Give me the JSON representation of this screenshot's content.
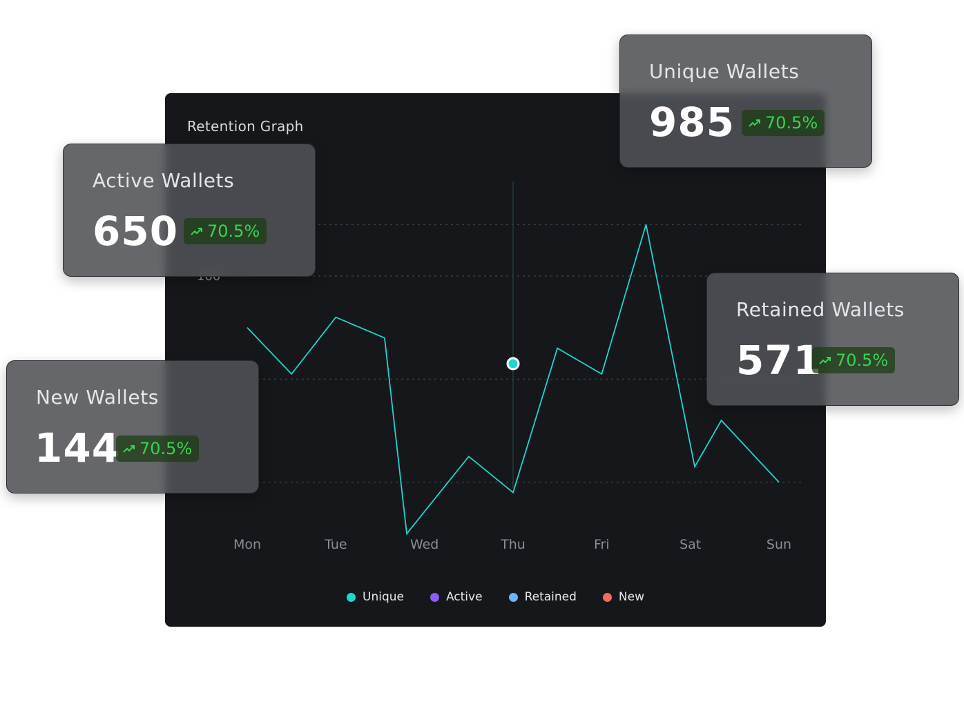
{
  "chart": {
    "title": "Retention Graph"
  },
  "chart_data": {
    "type": "line",
    "title": "Retention Graph",
    "categories": [
      "Mon",
      "Tue",
      "Wed",
      "Thu",
      "Fri",
      "Sat",
      "Sun"
    ],
    "x": [
      0,
      0.5,
      1,
      1.55,
      1.8,
      2.5,
      3,
      3.5,
      4,
      4.5,
      5.05,
      5.35,
      6
    ],
    "series": [
      {
        "name": "Unique",
        "color": "#1ed6cf",
        "y": [
          90,
          81,
          92,
          88,
          50,
          65,
          58,
          86,
          81,
          110,
          63,
          72,
          60
        ]
      }
    ],
    "y_tick_labels": [
      "100"
    ],
    "gridlines_y": [
      110,
      100,
      80,
      60
    ],
    "ylim": [
      55,
      115
    ],
    "highlight": {
      "category": "Thu",
      "y": 83
    },
    "grid": true
  },
  "legend": [
    {
      "label": "Unique",
      "color": "#1ed6cf"
    },
    {
      "label": "Active",
      "color": "#8b5cf6"
    },
    {
      "label": "Retained",
      "color": "#6cb4f5"
    },
    {
      "label": "New",
      "color": "#f26b5b"
    }
  ],
  "stats": {
    "unique": {
      "label": "Unique Wallets",
      "value": "985",
      "change": "70.5%"
    },
    "active": {
      "label": "Active Wallets",
      "value": "650",
      "change": "70.5%"
    },
    "retained": {
      "label": "Retained Wallets",
      "value": "571",
      "change": "70.5%"
    },
    "new": {
      "label": "New Wallets",
      "value": "144",
      "change": "70.5%"
    }
  },
  "colors": {
    "accent_line": "#1ed6cf",
    "positive": "#39d353"
  }
}
